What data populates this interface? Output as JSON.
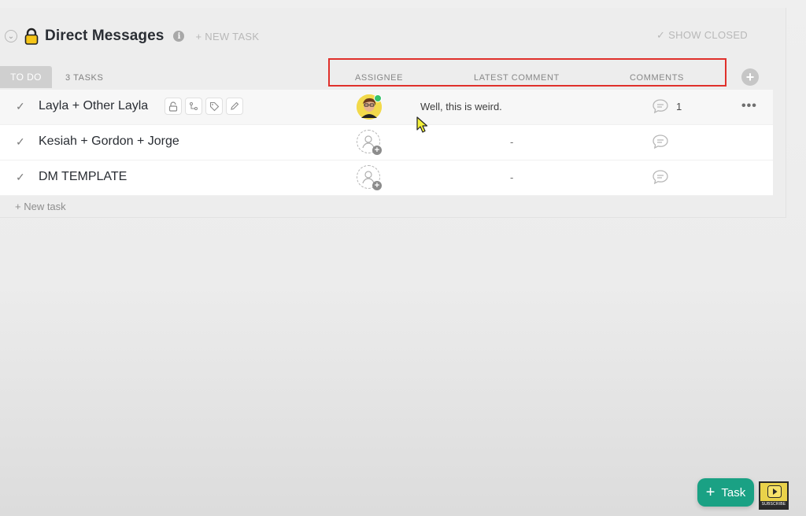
{
  "header": {
    "title": "Direct Messages",
    "info_icon_glyph": "i",
    "new_task_label": "+ NEW TASK",
    "show_closed_label": "SHOW CLOSED",
    "lock_icon": "lock-icon"
  },
  "status_group": {
    "status_label": "TO DO",
    "task_count": "3 TASKS",
    "status_color": "#cfcfcf"
  },
  "columns": {
    "assignee": "ASSIGNEE",
    "latest_comment": "LATEST COMMENT",
    "comments": "COMMENTS"
  },
  "tasks": [
    {
      "name": "Layla + Other Layla",
      "assignee": "avatar",
      "latest_comment": "Well, this is weird.",
      "comments_count": "1",
      "more": "•••"
    },
    {
      "name": "Kesiah + Gordon + Jorge",
      "assignee": "unassigned",
      "latest_comment": "-",
      "comments_count": ""
    },
    {
      "name": "DM TEMPLATE",
      "assignee": "unassigned",
      "latest_comment": "-",
      "comments_count": ""
    }
  ],
  "footer": {
    "new_task_label": "+ New task",
    "fab_label": "Task",
    "subscribe_label": "SUBSCRIBE"
  },
  "colors": {
    "accent": "#1aa184",
    "highlight": "#e0302b",
    "online": "#36c26b"
  }
}
